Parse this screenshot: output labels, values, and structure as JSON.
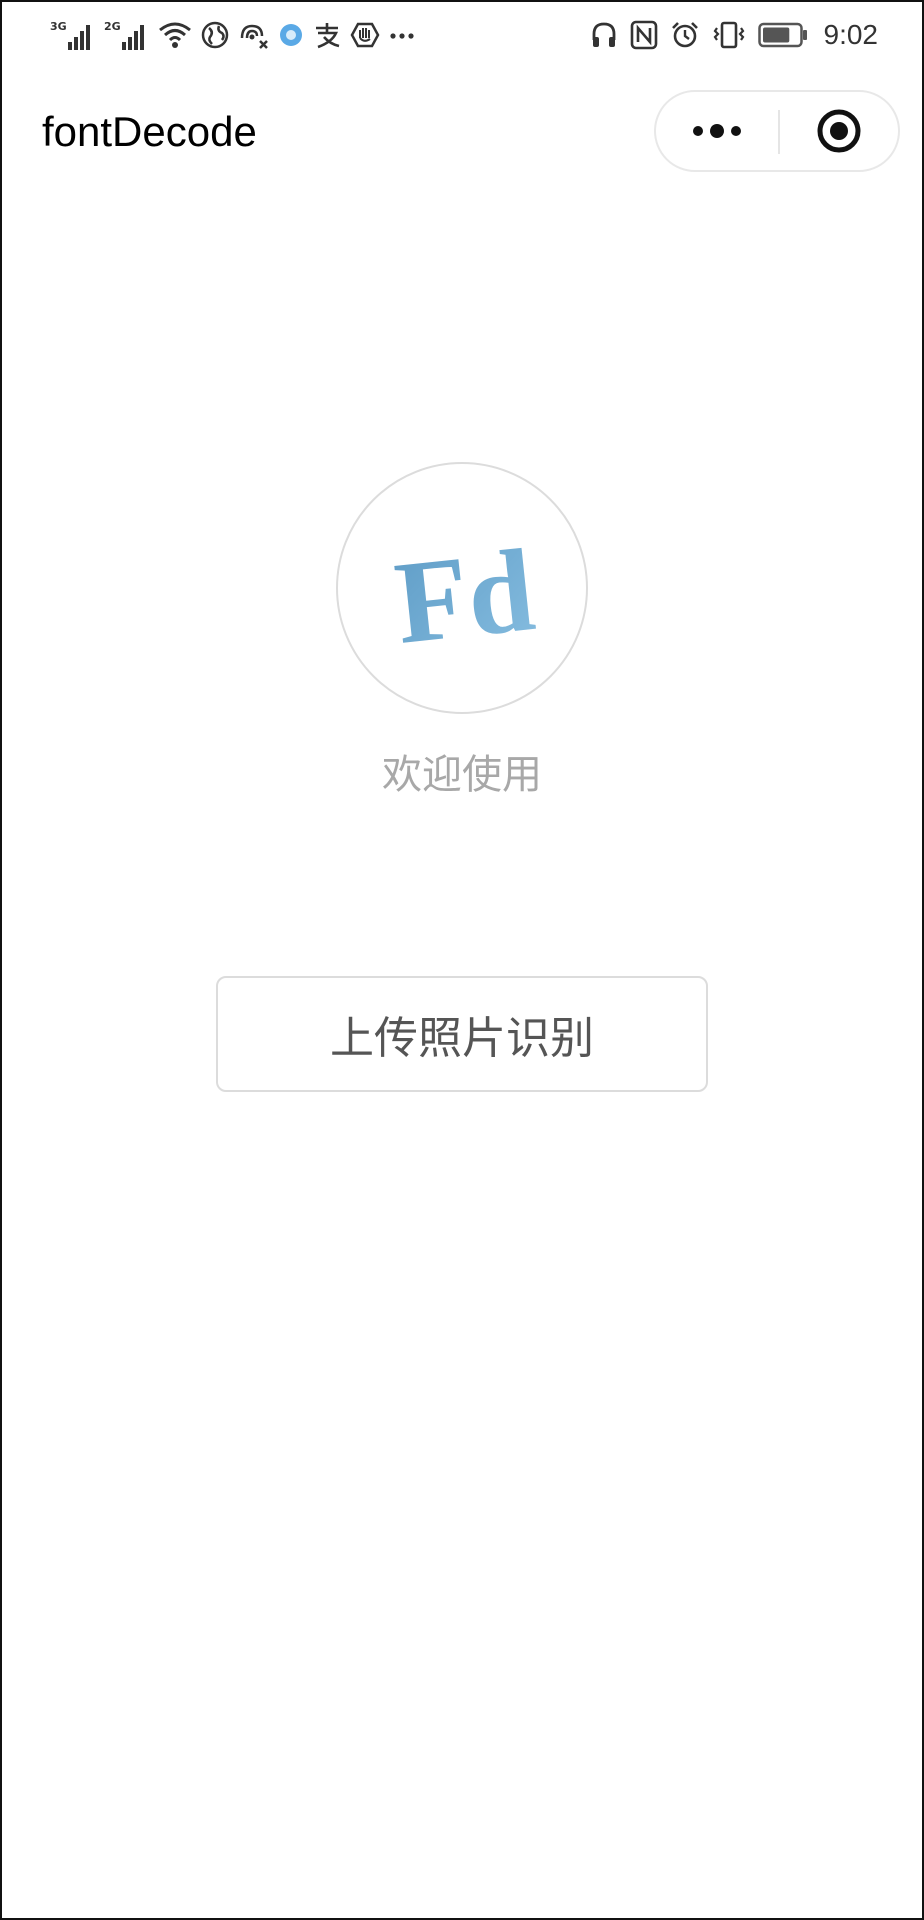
{
  "status_bar": {
    "signal_1_label": "3G",
    "signal_2_label": "2G",
    "time": "9:02",
    "left_icons": [
      "signal-3g-icon",
      "signal-2g-icon",
      "wifi-icon",
      "globe-icon",
      "hotspot-off-icon",
      "browser-app-icon",
      "alipay-icon",
      "hand-icon",
      "more-notifications-icon"
    ],
    "right_icons": [
      "headset-icon",
      "nfc-icon",
      "alarm-icon",
      "vibrate-icon",
      "battery-icon"
    ],
    "battery_level": 0.75
  },
  "nav_bar": {
    "title": "fontDecode",
    "capsule": {
      "more_icon": "more-dots-icon",
      "close_icon": "target-close-icon"
    }
  },
  "main": {
    "logo_text": "Fd",
    "logo_color": "#6fa8cf",
    "welcome_text": "欢迎使用",
    "upload_button_label": "上传照片识别"
  }
}
